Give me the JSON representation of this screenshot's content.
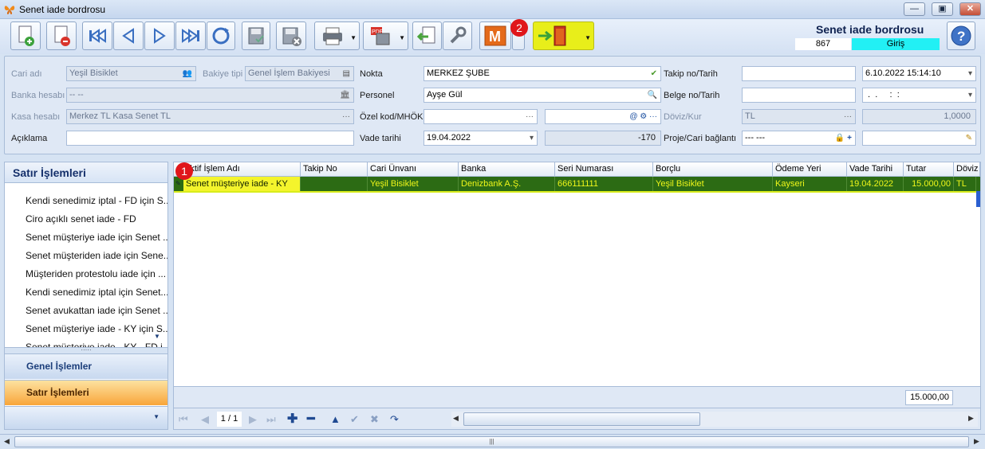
{
  "window": {
    "title": "Senet iade bordrosu"
  },
  "header": {
    "doc_title": "Senet iade bordrosu",
    "doc_number": "867",
    "doc_type": "Giriş"
  },
  "toolbar": {
    "m_label": "M",
    "badge_1": "1",
    "badge_2": "2"
  },
  "form": {
    "cari_adi_label": "Cari adı",
    "cari_adi": "Yeşil Bisiklet",
    "bakiye_tipi_label": "Bakiye tipi",
    "bakiye_tipi": "Genel İşlem Bakiyesi",
    "banka_label": "Banka hesabı",
    "banka": "-- --",
    "kasa_label": "Kasa hesabı",
    "kasa": "Merkez TL Kasa Senet TL",
    "aciklama_label": "Açıklama",
    "aciklama": "",
    "nokta_label": "Nokta",
    "nokta": "MERKEZ ŞUBE",
    "personel_label": "Personel",
    "personel": "Ayşe Gül",
    "ozel_kod_label": "Özel kod/MHÖK",
    "ozel_kod": "",
    "mhok": "",
    "vade_label": "Vade tarihi",
    "vade": "19.04.2022",
    "vade_gun": "-170",
    "takip_label": "Takip no/Tarih",
    "takip_no": "",
    "takip_tarih": "6.10.2022 15:14:10",
    "belge_label": "Belge no/Tarih",
    "belge_no": "",
    "belge_tarih": " .  .     :  :",
    "doviz_label": "Döviz/Kur",
    "doviz": "TL",
    "kur": "1,0000",
    "proje_label": "Proje/Cari bağlantı",
    "proje": "--- ---",
    "proje_cari": ""
  },
  "sidebar": {
    "title": "Satır İşlemleri",
    "items": [
      "Kendi senedimiz iptal - FD için S...",
      "Ciro açıklı senet iade - FD",
      "Senet müşteriye iade için Senet ...",
      "Senet müşteriden iade için Sene...",
      "Müşteriden protestolu iade için ...",
      "Kendi senedimiz iptal için Senet...",
      "Senet avukattan iade için Senet ...",
      "Senet müşteriye iade - KY için S...",
      "Senet müşteriye iade - KY - FD i..."
    ],
    "nav_general": "Genel İşlemler",
    "nav_active": "Satır İşlemleri"
  },
  "grid": {
    "columns": [
      "Aktif İşlem Adı",
      "Takip No",
      "Cari Ünvanı",
      "Banka",
      "Seri Numarası",
      "Borçlu",
      "Ödeme Yeri",
      "Vade Tarihi",
      "Tutar",
      "Döviz"
    ],
    "rows": [
      [
        "Senet müşteriye iade - KY",
        "",
        "Yeşil Bisiklet",
        "Denizbank A.Ş.",
        "666111111",
        "Yeşil Bisiklet",
        "Kayseri",
        "19.04.2022",
        "15.000,00",
        "TL"
      ]
    ],
    "total": "15.000,00",
    "page": "1 / 1"
  },
  "colors": {
    "row_selected": "#2c6b14",
    "row_text": "#eef61a",
    "highlight_yellow": "#f4f42c",
    "exit_button": "#e8ee1a",
    "doc_type_bg": "#22f0f4",
    "badge": "#e0161b"
  },
  "icons": [
    "new-document-icon",
    "delete-document-icon",
    "first-record-icon",
    "previous-record-icon",
    "next-record-icon",
    "last-record-icon",
    "refresh-icon",
    "save-icon",
    "cancel-save-icon",
    "print-icon",
    "pdf-save-icon",
    "import-icon",
    "settings-wrench-icon",
    "m-icon",
    "exit-door-icon",
    "help-icon"
  ]
}
